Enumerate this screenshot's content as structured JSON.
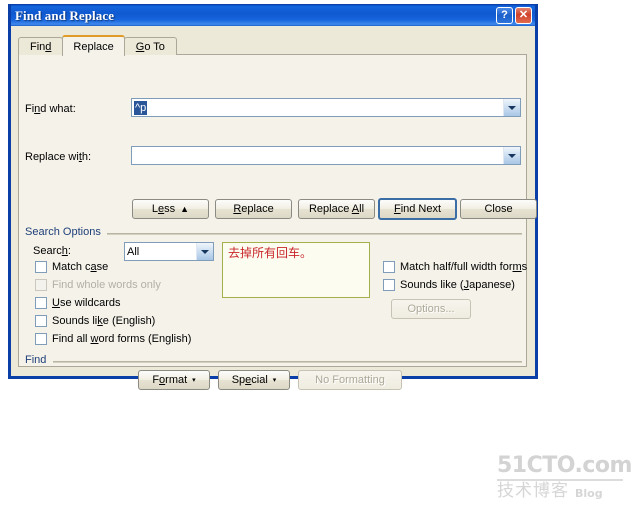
{
  "window": {
    "title": "Find and Replace",
    "help_button": "?",
    "close_button": "✕"
  },
  "tabs": [
    {
      "label": "Find",
      "underline": "d",
      "active": false
    },
    {
      "label": "Replace",
      "underline": "",
      "active": true
    },
    {
      "label": "Go To",
      "underline": "G",
      "active": false
    }
  ],
  "fields": {
    "find_what": {
      "label": "Find what:",
      "value": "^p",
      "selected": true
    },
    "replace_with": {
      "label": "Replace with:",
      "value": "",
      "selected": false
    }
  },
  "buttons": {
    "less": "Less",
    "less_glyph": "▲",
    "replace": "Replace",
    "replace_all": "Replace All",
    "find_next": "Find Next",
    "close": "Close",
    "options": "Options...",
    "format": "Format",
    "special": "Special",
    "no_formatting": "No Formatting",
    "dropdown_glyph": "▾"
  },
  "search_options": {
    "group_label": "Search Options",
    "search_label": "Search:",
    "search_value": "All",
    "left_checkboxes": [
      {
        "label": "Match case",
        "checked": false,
        "disabled": false
      },
      {
        "label": "Find whole words only",
        "checked": false,
        "disabled": true
      },
      {
        "label": "Use wildcards",
        "checked": false,
        "disabled": false
      },
      {
        "label": "Sounds like (English)",
        "checked": false,
        "disabled": false
      },
      {
        "label": "Find all word forms (English)",
        "checked": false,
        "disabled": false
      }
    ],
    "right_checkboxes": [
      {
        "label": "Match half/full width forms",
        "checked": false,
        "disabled": false
      },
      {
        "label": "Sounds like (Japanese)",
        "checked": false,
        "disabled": false
      }
    ]
  },
  "find_group": {
    "group_label": "Find"
  },
  "annotation": {
    "text": "去掉所有回车。",
    "color": "#c8252a",
    "border_color": "#a3b04a",
    "background": "#fdfcf0"
  },
  "watermark": {
    "top": "51CTO.com",
    "bottom_cn": "技术博客",
    "bottom_en": "Blog"
  },
  "colors": {
    "titlebar_blue": "#1565dc",
    "dialog_border": "#0a3fa8",
    "dialog_face": "#ece9d8",
    "panel_face": "#f4f2e9",
    "active_tab_accent": "#e09a28",
    "group_label": "#1f3f7a",
    "selection_blue": "#2a5699"
  }
}
